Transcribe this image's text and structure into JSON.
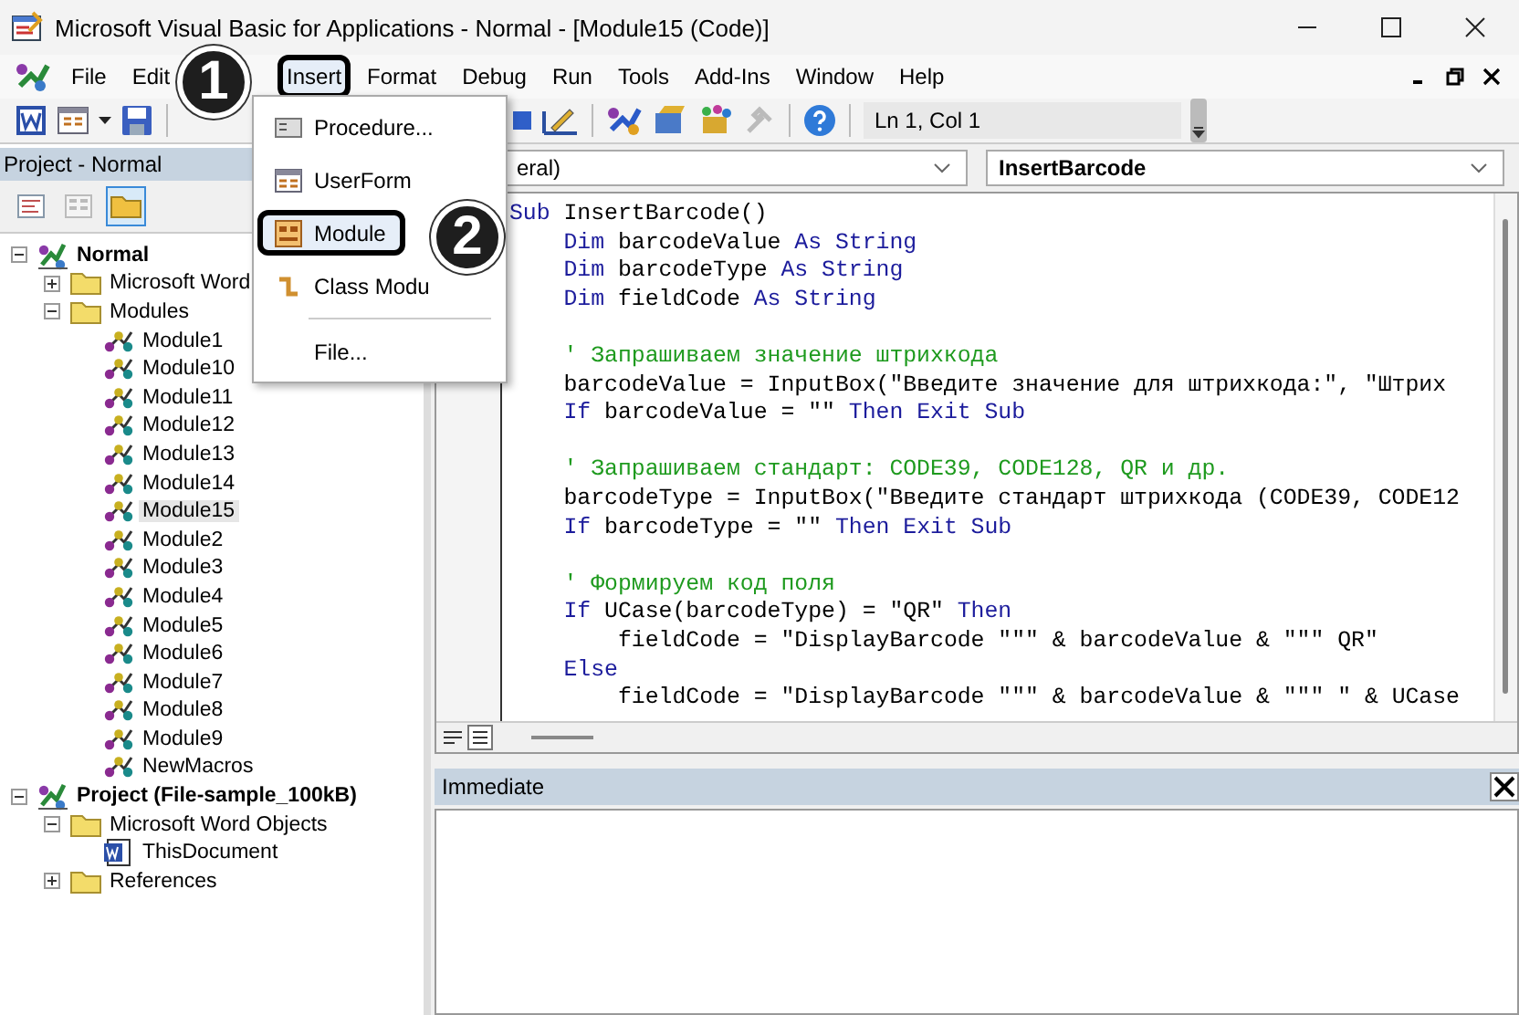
{
  "window": {
    "title": "Microsoft Visual Basic for Applications - Normal - [Module15 (Code)]"
  },
  "menu": [
    {
      "label": "File",
      "selected": false
    },
    {
      "label": "Edit",
      "selected": false
    },
    {
      "label": "Insert",
      "selected": true
    },
    {
      "label": "Format",
      "selected": false
    },
    {
      "label": "Debug",
      "selected": false
    },
    {
      "label": "Run",
      "selected": false
    },
    {
      "label": "Tools",
      "selected": false
    },
    {
      "label": "Add-Ins",
      "selected": false
    },
    {
      "label": "Window",
      "selected": false
    },
    {
      "label": "Help",
      "selected": false
    }
  ],
  "insert_menu": [
    {
      "label": "Procedure...",
      "kind": "procedure",
      "highlighted": false,
      "separator_before": false
    },
    {
      "label": "UserForm",
      "kind": "userform",
      "highlighted": false,
      "separator_before": false
    },
    {
      "label": "Module",
      "kind": "module",
      "highlighted": true,
      "separator_before": false
    },
    {
      "label": "Class Modu",
      "kind": "class",
      "highlighted": false,
      "separator_before": false
    },
    {
      "label": "File...",
      "kind": "file",
      "highlighted": false,
      "separator_before": true
    }
  ],
  "toolbar": {
    "position": "Ln 1, Col 1"
  },
  "project": {
    "title": "Project - Normal",
    "buttons": [
      {
        "kind": "view-code",
        "selected": false
      },
      {
        "kind": "view-object",
        "selected": false
      },
      {
        "kind": "toggle-folders",
        "selected": true
      }
    ],
    "tree": [
      {
        "label": "Normal",
        "kind": "project",
        "expanded": true,
        "selected": false,
        "children": [
          {
            "label": "Microsoft Word",
            "kind": "folder",
            "expanded": false,
            "selected": false
          },
          {
            "label": "Modules",
            "kind": "folder",
            "expanded": true,
            "selected": false,
            "children": [
              {
                "label": "Module1",
                "kind": "module",
                "selected": false
              },
              {
                "label": "Module10",
                "kind": "module",
                "selected": false
              },
              {
                "label": "Module11",
                "kind": "module",
                "selected": false
              },
              {
                "label": "Module12",
                "kind": "module",
                "selected": false
              },
              {
                "label": "Module13",
                "kind": "module",
                "selected": false
              },
              {
                "label": "Module14",
                "kind": "module",
                "selected": false
              },
              {
                "label": "Module15",
                "kind": "module",
                "selected": true
              },
              {
                "label": "Module2",
                "kind": "module",
                "selected": false
              },
              {
                "label": "Module3",
                "kind": "module",
                "selected": false
              },
              {
                "label": "Module4",
                "kind": "module",
                "selected": false
              },
              {
                "label": "Module5",
                "kind": "module",
                "selected": false
              },
              {
                "label": "Module6",
                "kind": "module",
                "selected": false
              },
              {
                "label": "Module7",
                "kind": "module",
                "selected": false
              },
              {
                "label": "Module8",
                "kind": "module",
                "selected": false
              },
              {
                "label": "Module9",
                "kind": "module",
                "selected": false
              },
              {
                "label": "NewMacros",
                "kind": "module",
                "selected": false
              }
            ]
          }
        ]
      },
      {
        "label": "Project (File-sample_100kB)",
        "kind": "project",
        "expanded": true,
        "selected": false,
        "children": [
          {
            "label": "Microsoft Word Objects",
            "kind": "folder",
            "expanded": true,
            "selected": false,
            "children": [
              {
                "label": "ThisDocument",
                "kind": "document",
                "selected": false
              }
            ]
          },
          {
            "label": "References",
            "kind": "folder",
            "expanded": false,
            "selected": false
          }
        ]
      }
    ]
  },
  "code": {
    "object_box": "eral)",
    "procedure_box": "InsertBarcode",
    "lines": [
      {
        "kind": "top",
        "segments": [
          {
            "kind": "keyword",
            "text": "Sub"
          },
          {
            "kind": "plain",
            "text": " InsertBarcode()"
          }
        ]
      },
      {
        "kind": "body",
        "segments": [
          {
            "kind": "keyword",
            "text": "Dim"
          },
          {
            "kind": "plain",
            "text": " barcodeValue "
          },
          {
            "kind": "keyword",
            "text": "As String"
          }
        ]
      },
      {
        "kind": "body",
        "segments": [
          {
            "kind": "keyword",
            "text": "Dim"
          },
          {
            "kind": "plain",
            "text": " barcodeType "
          },
          {
            "kind": "keyword",
            "text": "As String"
          }
        ]
      },
      {
        "kind": "body",
        "segments": [
          {
            "kind": "keyword",
            "text": "Dim"
          },
          {
            "kind": "plain",
            "text": " fieldCode "
          },
          {
            "kind": "keyword",
            "text": "As String"
          }
        ]
      },
      {
        "kind": "blank"
      },
      {
        "kind": "body",
        "segments": [
          {
            "kind": "comment",
            "text": "' Запрашиваем значение штрихкода"
          }
        ]
      },
      {
        "kind": "body",
        "segments": [
          {
            "kind": "plain",
            "text": "barcodeValue = InputBox(\"Введите значение для штрихкода:\", \"Штрих"
          }
        ]
      },
      {
        "kind": "body",
        "segments": [
          {
            "kind": "keyword",
            "text": "If"
          },
          {
            "kind": "plain",
            "text": " barcodeValue = \"\" "
          },
          {
            "kind": "keyword",
            "text": "Then Exit Sub"
          }
        ]
      },
      {
        "kind": "blank"
      },
      {
        "kind": "body",
        "segments": [
          {
            "kind": "comment",
            "text": "' Запрашиваем стандарт: CODE39, CODE128, QR и др."
          }
        ]
      },
      {
        "kind": "body",
        "segments": [
          {
            "kind": "plain",
            "text": "barcodeType = InputBox(\"Введите стандарт штрихкода (CODE39, CODE12"
          }
        ]
      },
      {
        "kind": "body",
        "segments": [
          {
            "kind": "keyword",
            "text": "If"
          },
          {
            "kind": "plain",
            "text": " barcodeType = \"\" "
          },
          {
            "kind": "keyword",
            "text": "Then Exit Sub"
          }
        ]
      },
      {
        "kind": "blank"
      },
      {
        "kind": "body",
        "segments": [
          {
            "kind": "comment",
            "text": "' Формируем код поля"
          }
        ]
      },
      {
        "kind": "body",
        "segments": [
          {
            "kind": "keyword",
            "text": "If"
          },
          {
            "kind": "plain",
            "text": " UCase(barcodeType) = \"QR\" "
          },
          {
            "kind": "keyword",
            "text": "Then"
          }
        ]
      },
      {
        "kind": "nested",
        "segments": [
          {
            "kind": "plain",
            "text": "fieldCode = \"DisplayBarcode \"\"\" & barcodeValue & \"\"\" QR\""
          }
        ]
      },
      {
        "kind": "body",
        "segments": [
          {
            "kind": "keyword",
            "text": "Else"
          }
        ]
      },
      {
        "kind": "nested",
        "segments": [
          {
            "kind": "plain",
            "text": "fieldCode = \"DisplayBarcode \"\"\" & barcodeValue & \"\"\" \" & UCase"
          }
        ]
      }
    ]
  },
  "immediate": {
    "title": "Immediate"
  },
  "callouts": [
    {
      "label": "1"
    },
    {
      "label": "2"
    }
  ]
}
